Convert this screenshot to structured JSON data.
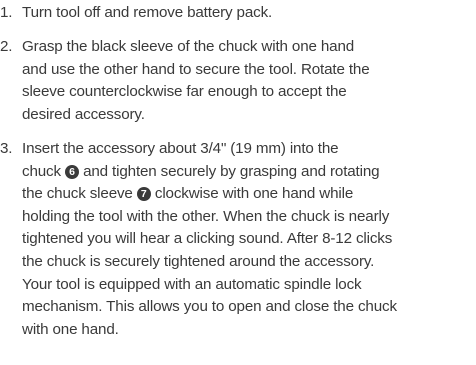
{
  "steps": [
    {
      "number": "1.",
      "lines": [
        "Turn tool off and remove battery pack."
      ]
    },
    {
      "number": "2.",
      "lines": [
        "Grasp the black sleeve of the chuck with one hand",
        "and use the other hand to secure the tool. Rotate the",
        "sleeve counterclockwise far enough to accept the",
        "desired accessory."
      ]
    },
    {
      "number": "3.",
      "line0": "Insert the accessory about 3/4\" (19 mm) into the",
      "line1_before": "chuck",
      "callout_chuck": "6",
      "line1_after": "and tighten securely by grasping and rotating",
      "line2_before": "the chuck sleeve",
      "callout_sleeve": "7",
      "line2_after": "clockwise with one hand while",
      "lines_rest": [
        "holding the tool with the other. When the chuck is nearly",
        "tightened you will hear a clicking sound. After 8-12 clicks",
        "the chuck is securely tightened around the accessory.",
        "Your tool is equipped with an automatic spindle lock",
        "mechanism. This allows you to open and close the chuck",
        "with one hand."
      ]
    }
  ]
}
